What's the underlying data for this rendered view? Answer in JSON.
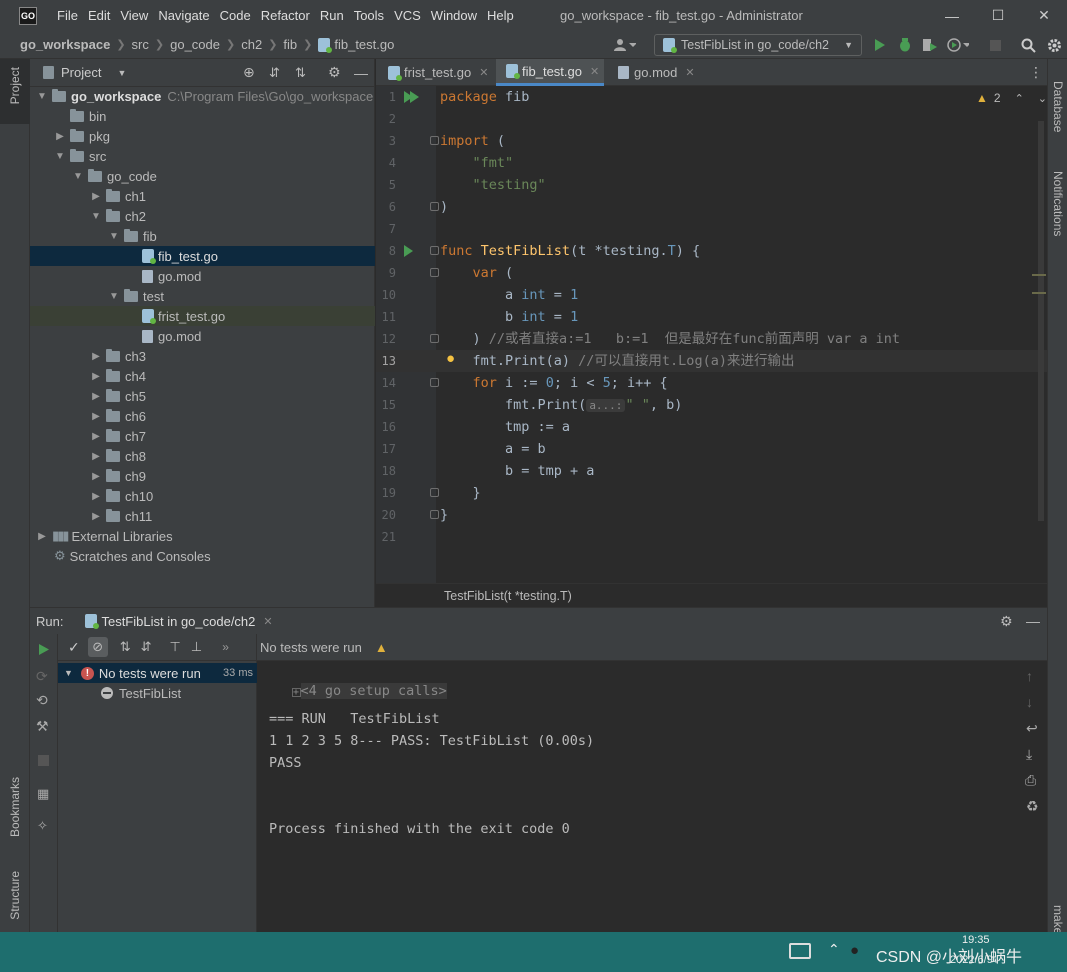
{
  "titlebar": {
    "logo": "GO",
    "menu": [
      "File",
      "Edit",
      "View",
      "Navigate",
      "Code",
      "Refactor",
      "Run",
      "Tools",
      "VCS",
      "Window",
      "Help"
    ],
    "window_title": "go_workspace - fib_test.go - Administrator"
  },
  "navbar": {
    "crumbs": [
      "go_workspace",
      "src",
      "go_code",
      "ch2",
      "fib",
      "fib_test.go"
    ],
    "run_config": "TestFibList in go_code/ch2"
  },
  "left_stripe": {
    "project": "Project",
    "bookmarks": "Bookmarks",
    "structure": "Structure"
  },
  "right_stripe": {
    "database": "Database",
    "notifications": "Notifications",
    "make": "make"
  },
  "project": {
    "title": "Project",
    "root_name": "go_workspace",
    "root_path": "C:\\Program Files\\Go\\go_workspace",
    "items": {
      "bin": "bin",
      "pkg": "pkg",
      "src": "src",
      "go_code": "go_code",
      "ch1": "ch1",
      "ch2": "ch2",
      "fib": "fib",
      "fib_test": "fib_test.go",
      "fib_mod": "go.mod",
      "test": "test",
      "frist_test": "frist_test.go",
      "test_mod": "go.mod",
      "ch3": "ch3",
      "ch4": "ch4",
      "ch5": "ch5",
      "ch6": "ch6",
      "ch7": "ch7",
      "ch8": "ch8",
      "ch9": "ch9",
      "ch10": "ch10",
      "ch11": "ch11",
      "ext_libs": "External Libraries",
      "scratches": "Scratches and Consoles"
    }
  },
  "editor": {
    "tabs": [
      "frist_test.go",
      "fib_test.go",
      "go.mod"
    ],
    "warnings": "2",
    "line_numbers": [
      "1",
      "2",
      "3",
      "4",
      "5",
      "6",
      "7",
      "8",
      "9",
      "10",
      "11",
      "12",
      "13",
      "14",
      "15",
      "16",
      "17",
      "18",
      "19",
      "20",
      "21"
    ],
    "code": {
      "l1_kw": "package",
      "l1_name": " fib",
      "l3_kw": "import",
      "l3_rest": " (",
      "l4": "    \"fmt\"",
      "l5": "    \"testing\"",
      "l6": ")",
      "l8_kw": "func",
      "l8_fn": " TestFibList",
      "l8_rest1": "(t *testing.",
      "l8_type": "T",
      "l8_rest2": ") {",
      "l9_kw": "    var",
      "l9_rest": " (",
      "l10_a": "        a ",
      "l10_type": "int",
      "l10_eq": " = ",
      "l10_num": "1",
      "l11_a": "        b ",
      "l11_type": "int",
      "l11_eq": " = ",
      "l11_num": "1",
      "l12_code": "    ) ",
      "l12_comment": "//或者直接a:=1   b:=1  但是最好在func前面声明 var a int",
      "l13_code": "    fmt.Print(a) ",
      "l13_comment": "//可以直接用t.Log(a)来进行输出",
      "l14_kw": "    for",
      "l14_rest1": " i := ",
      "l14_n0": "0",
      "l14_rest2": "; i < ",
      "l14_n5": "5",
      "l14_rest3": "; i++ {",
      "l15_pre": "        fmt.Print(",
      "l15_hint": "a...:",
      "l15_str": "\" \"",
      "l15_post": ", b)",
      "l16": "        tmp := a",
      "l17": "        a = b",
      "l18": "        b = tmp + a",
      "l19": "    }",
      "l20": "}"
    },
    "breadcrumb": "TestFibList(t *testing.T)"
  },
  "run": {
    "label": "Run:",
    "tab": "TestFibList in go_code/ch2",
    "status": "No tests were run",
    "tree_root": "No tests were run",
    "tree_time": "33 ms",
    "tree_child": "TestFibList",
    "console": {
      "setup": "<4 go setup calls>",
      "line1": "=== RUN   TestFibList",
      "line2": "1 1 2 3 5 8--- PASS: TestFibList (0.00s)",
      "line3": "PASS",
      "line4": "Process finished with the exit code 0"
    }
  },
  "taskbar": {
    "watermark": "CSDN @小刘小蜗牛",
    "time": "19:35",
    "date": "2022/6/9"
  },
  "colors": {
    "keyword": "#cc7832",
    "string": "#6a8759",
    "function": "#ffc66d",
    "number": "#6897bb",
    "comment": "#808080",
    "run_green": "#499c54",
    "selection": "#0d293e",
    "accent_tab": "#4a88c7"
  }
}
